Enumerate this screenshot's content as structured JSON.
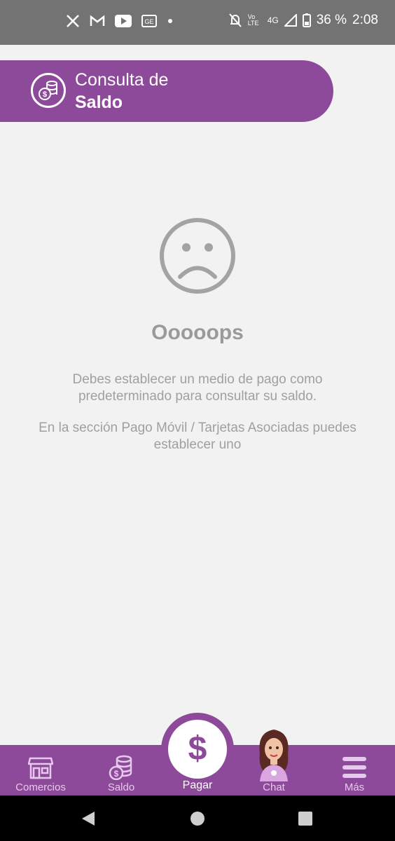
{
  "status_bar": {
    "time": "2:08",
    "battery_text": "36 %",
    "network": "4G",
    "volte": "Vo LTE",
    "notification_icons": [
      "x-icon",
      "gmail-icon",
      "youtube-icon",
      "ge-icon",
      "dot-icon"
    ],
    "status_icons": [
      "mute-icon",
      "volte-icon",
      "signal-icon",
      "battery-icon"
    ]
  },
  "header": {
    "title_line1": "Consulta de",
    "title_line2": "Saldo",
    "icon": "coins-icon"
  },
  "empty_state": {
    "icon": "sad-face-icon",
    "title": "Ooooops",
    "message1": "Debes establecer un medio de pago como predeterminado para consultar su saldo.",
    "message2": "En la sección Pago Móvil / Tarjetas Asociadas puedes establecer uno"
  },
  "bottom_nav": {
    "items": [
      {
        "label": "Comercios",
        "icon": "store-icon"
      },
      {
        "label": "Saldo",
        "icon": "coins-icon"
      },
      {
        "label": "Pagar",
        "icon": "dollar-icon"
      },
      {
        "label": "Chat",
        "icon": "avatar-icon"
      },
      {
        "label": "Más",
        "icon": "menu-icon"
      }
    ]
  },
  "colors": {
    "brand_purple": "#8e4a9a",
    "status_bar": "#737373",
    "background": "#f2f2f2",
    "text_gray": "#a0a0a0"
  }
}
